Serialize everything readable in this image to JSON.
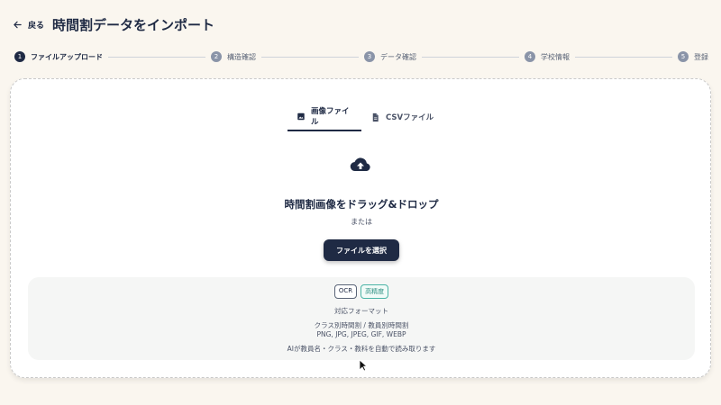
{
  "header": {
    "back_label": "戻る",
    "title": "時間割データをインポート"
  },
  "stepper": {
    "steps": [
      {
        "number": "1",
        "label": "ファイルアップロード"
      },
      {
        "number": "2",
        "label": "構造確認"
      },
      {
        "number": "3",
        "label": "データ確認"
      },
      {
        "number": "4",
        "label": "学校情報"
      },
      {
        "number": "5",
        "label": "登録"
      }
    ]
  },
  "tabs": [
    {
      "label": "画像ファイル",
      "icon": "image-icon"
    },
    {
      "label": "CSVファイル",
      "icon": "file-icon"
    }
  ],
  "upload": {
    "icon": "cloud-upload-icon",
    "title": "時間割画像をドラッグ&ドロップ",
    "or_text": "または",
    "button_label": "ファイルを選択"
  },
  "info": {
    "badges": [
      "OCR",
      "高精度"
    ],
    "heading": "対応フォーマット",
    "types": "クラス別時間割 / 教員別時間割",
    "extensions": "PNG, JPG, JPEG, GIF, WEBP",
    "note": "AIが教員名・クラス・教科を自動で読み取ります"
  },
  "colors": {
    "primary": "#1f2a44",
    "background": "#faf6ef",
    "accent_teal": "#4bb4a6"
  }
}
